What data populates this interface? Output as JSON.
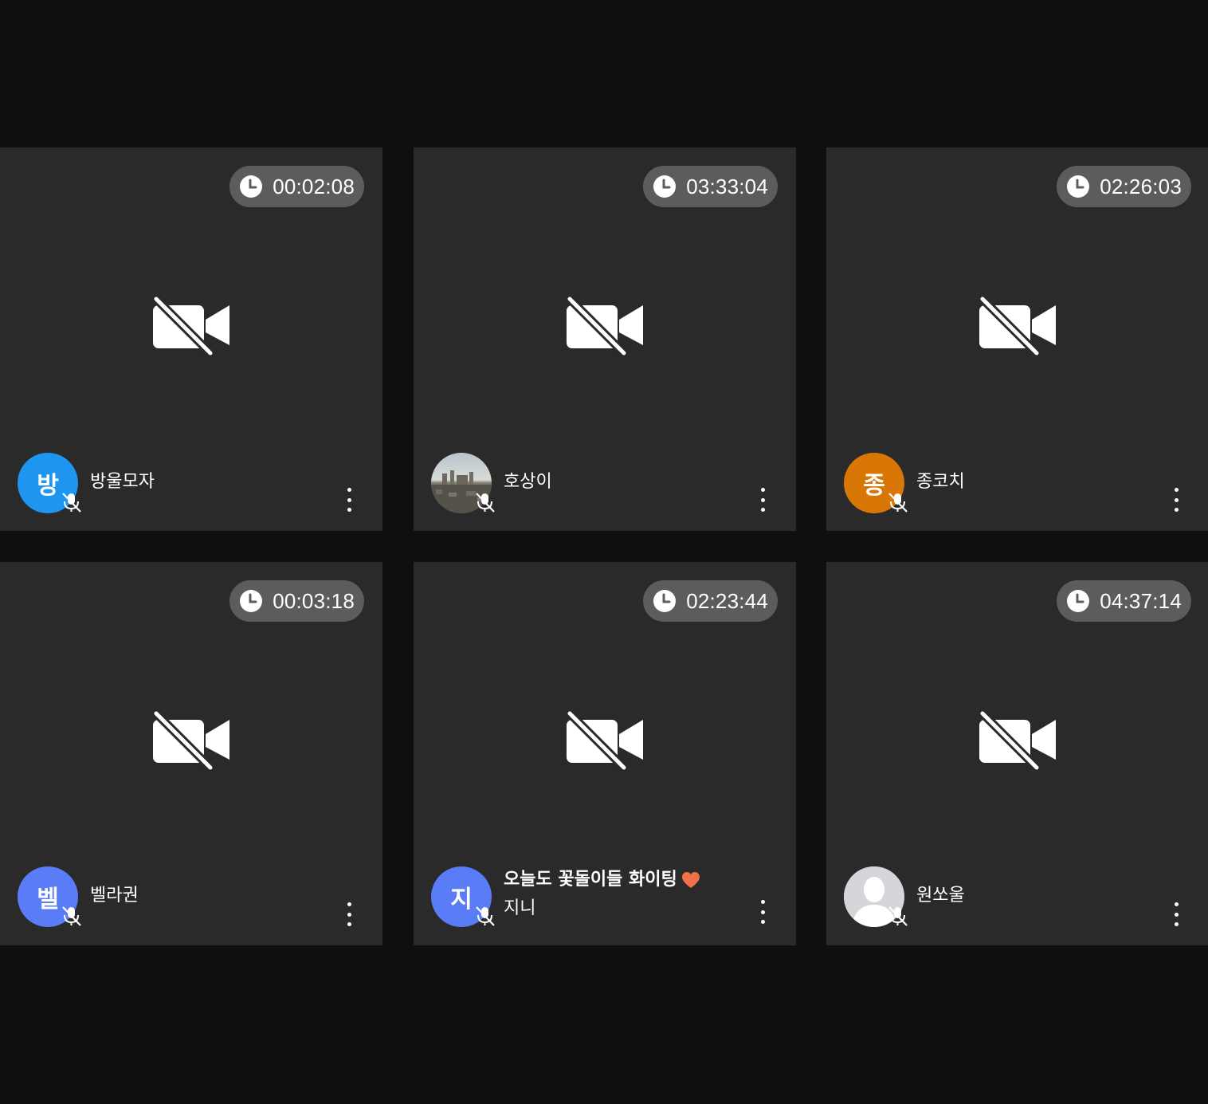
{
  "colors": {
    "background": "#0f0f0f",
    "tile": "#2a2a2a",
    "timer_pill": "#5c5c5c",
    "heart": "#f0704a"
  },
  "tiles": [
    {
      "timer": "00:02:08",
      "avatar": {
        "type": "initial",
        "text": "방",
        "color": "#1e95ee"
      },
      "name": "방울모자",
      "status": "",
      "mic": "mic-off-icon"
    },
    {
      "timer": "03:33:04",
      "avatar": {
        "type": "photo",
        "text": "",
        "color": "#8a8a8a"
      },
      "name": "호상이",
      "status": "",
      "mic": "mic-off-icon"
    },
    {
      "timer": "02:26:03",
      "avatar": {
        "type": "initial",
        "text": "종",
        "color": "#d97706"
      },
      "name": "종코치",
      "status": "",
      "mic": "mic-off-icon"
    },
    {
      "timer": "00:03:18",
      "avatar": {
        "type": "initial",
        "text": "벨",
        "color": "#5b7cf7"
      },
      "name": "벨라권",
      "status": "",
      "mic": "mic-off-icon"
    },
    {
      "timer": "02:23:44",
      "avatar": {
        "type": "initial",
        "text": "지",
        "color": "#5b7cf7"
      },
      "name": "지니",
      "status": "오늘도 꽃돌이들 화이팅",
      "status_icon": "heart-icon",
      "mic": "mic-off-icon"
    },
    {
      "timer": "04:37:14",
      "avatar": {
        "type": "default",
        "text": "",
        "color": "#d4d6d9"
      },
      "name": "원쏘울",
      "status": "",
      "mic": "mic-off-icon"
    }
  ]
}
